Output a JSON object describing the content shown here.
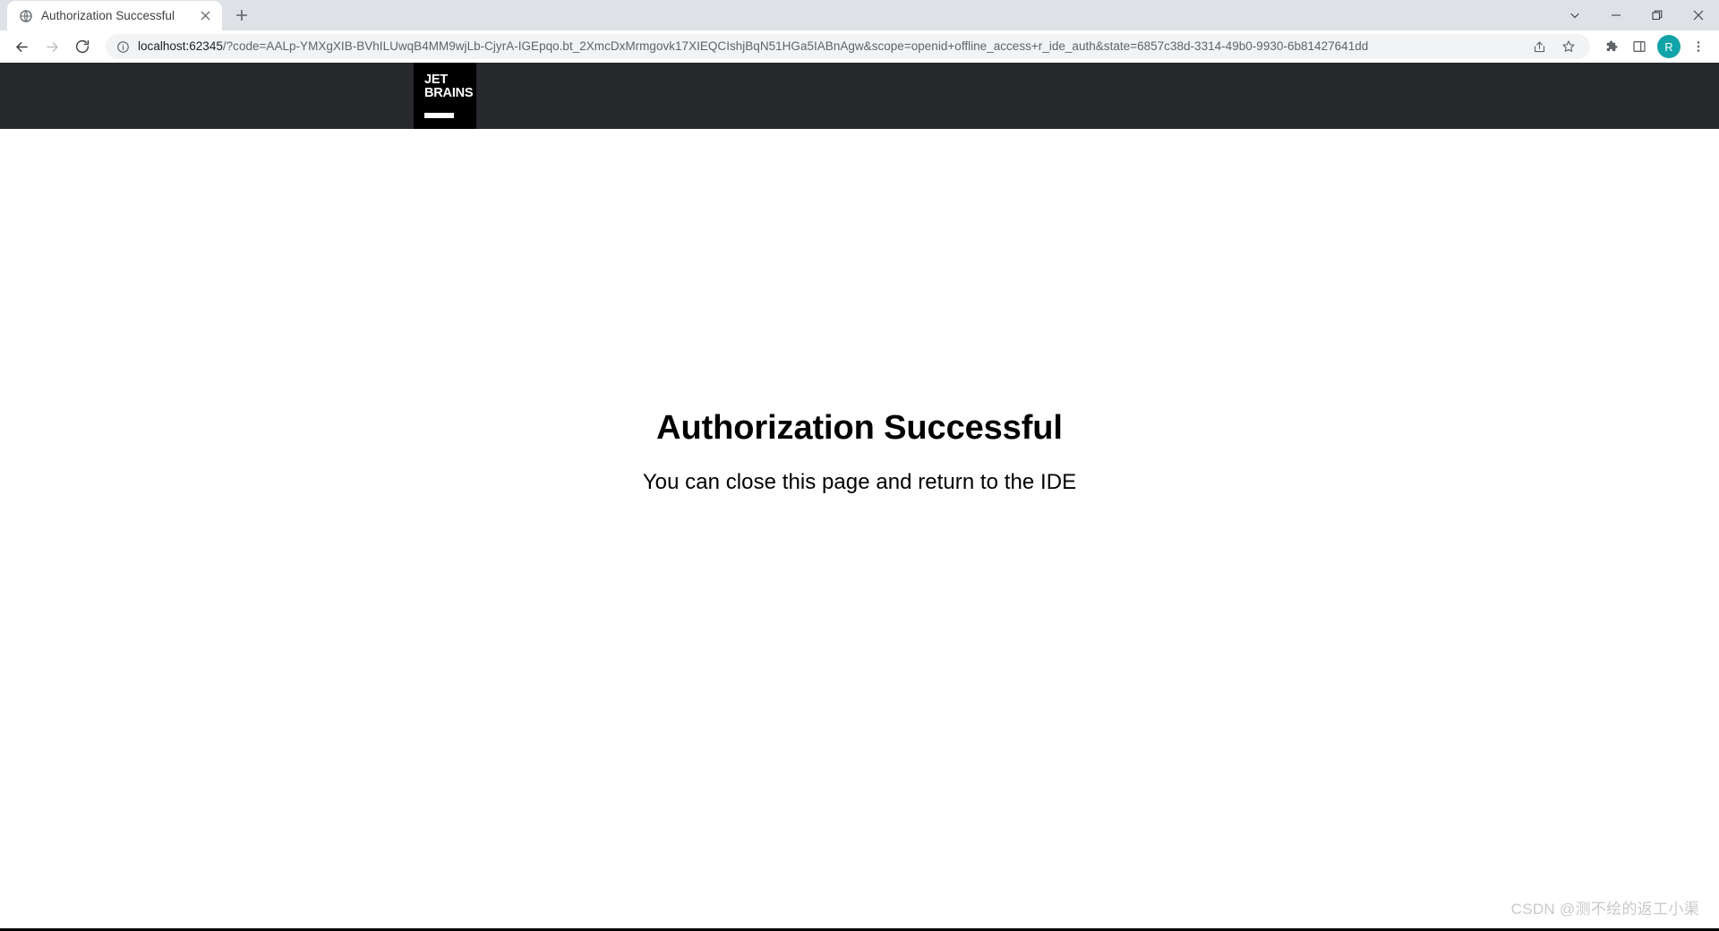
{
  "browser": {
    "tab": {
      "title": "Authorization Successful",
      "favicon_icon": "globe-icon",
      "close_icon": "close-icon"
    },
    "new_tab_icon": "plus-icon",
    "window_controls": {
      "tab_search_icon": "chevron-down-icon",
      "minimize_icon": "minimize-icon",
      "maximize_icon": "maximize-restore-icon",
      "close_icon": "close-icon"
    },
    "navigation": {
      "back_icon": "arrow-left-icon",
      "forward_icon": "arrow-right-icon",
      "reload_icon": "reload-icon"
    },
    "omnibox": {
      "info_icon": "info-circle-icon",
      "url_host": "localhost:62345",
      "url_path": "/?code=AALp-YMXgXIB-BVhILUwqB4MM9wjLb-CjyrA-IGEpqo.bt_2XmcDxMrmgovk17XIEQCIshjBqN51HGa5IABnAgw&scope=openid+offline_access+r_ide_auth&state=6857c38d-3314-49b0-9930-6b81427641dd",
      "share_icon": "share-icon",
      "bookmark_icon": "star-icon"
    },
    "toolbar": {
      "extensions_icon": "puzzle-icon",
      "side_panel_icon": "side-panel-icon",
      "menu_icon": "three-dot-menu-icon",
      "profile_initial": "R",
      "profile_color": "#12a3a8"
    }
  },
  "page": {
    "logo": {
      "line1": "JET",
      "line2": "BRAINS",
      "background": "#000000"
    },
    "header_background": "#27282c",
    "heading": "Authorization Successful",
    "subheading": "You can close this page and return to the IDE",
    "watermark": "CSDN @测不绘的返工小渠"
  }
}
